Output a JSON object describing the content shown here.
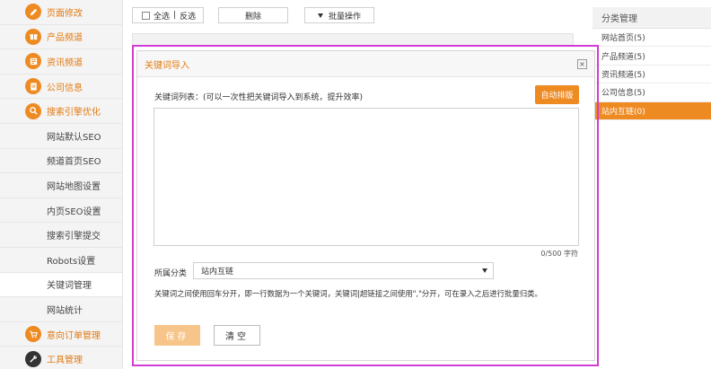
{
  "sidebar": {
    "top_items": [
      {
        "label": "页面修改",
        "icon": "pencil-icon"
      },
      {
        "label": "产品频道",
        "icon": "gift-icon"
      },
      {
        "label": "资讯频道",
        "icon": "news-icon"
      },
      {
        "label": "公司信息",
        "icon": "document-icon"
      },
      {
        "label": "搜索引擎优化",
        "icon": "search-icon"
      }
    ],
    "seo_sub_items": [
      {
        "label": "网站默认SEO"
      },
      {
        "label": "频道首页SEO"
      },
      {
        "label": "网站地图设置"
      },
      {
        "label": "内页SEO设置"
      },
      {
        "label": "搜索引擎提交"
      },
      {
        "label": "Robots设置"
      },
      {
        "label": "关键词管理"
      },
      {
        "label": "网站统计"
      }
    ],
    "bottom_items": [
      {
        "label": "意向订单管理",
        "icon": "cart-icon"
      },
      {
        "label": "工具管理",
        "icon": "wrench-icon"
      }
    ]
  },
  "toolbar": {
    "select_all": "全选",
    "separator": "|",
    "invert": "反选",
    "delete": "删除",
    "batch": "批量操作"
  },
  "right_panel": {
    "title": "分类管理",
    "items": [
      {
        "label": "网站首页(5)"
      },
      {
        "label": "产品频道(5)"
      },
      {
        "label": "资讯频道(5)"
      },
      {
        "label": "公司信息(5)"
      },
      {
        "label": "站内互链(0)"
      }
    ]
  },
  "modal": {
    "title": "关键词导入",
    "close": "×",
    "keyword_label": "关键词列表：(可以一次性把关键词导入到系统，提升效率)",
    "auto_sort": "自动排版",
    "textarea_value": "",
    "counter": "0/500 字符",
    "category_label": "所属分类",
    "category_value": "站内互链",
    "note": "关键词之间使用回车分开，即一行数据为一个关键词，关键词|超链接之间使用\",\"分开，可在录入之后进行批量归类。",
    "save": "保存",
    "clear": "清空"
  },
  "colors": {
    "accent": "#ee8a22",
    "accent_light": "#f7c58a",
    "highlight_border": "#d23bd5"
  }
}
